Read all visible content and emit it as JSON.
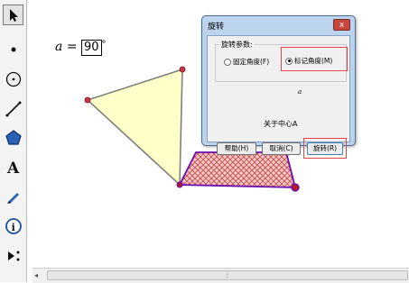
{
  "parameter": {
    "name": "a",
    "equals": "=",
    "value": "90",
    "unit": "°"
  },
  "dialog": {
    "title": "旋转",
    "close_label": "x",
    "group_label": "旋转参数:",
    "option_fixed": "固定角度(F)",
    "option_marked": "标记角度(M)",
    "angle_var": "a",
    "center_text": "关于中心A",
    "buttons": {
      "help": "帮助(H)",
      "cancel": "取消(C)",
      "rotate": "旋转(R)"
    },
    "selected_option": "option_marked"
  },
  "colors": {
    "triangle_fill": "#ffffc9",
    "triangle_stroke": "#7f7f7f",
    "trapezoid_fill": "#f4c7c7",
    "trapezoid_stroke": "#6a0dad",
    "point": "#b3162a",
    "highlight": "#e5434b",
    "dialog_frame": "#bcd3ee"
  },
  "toolbar": {
    "tools": [
      "arrow-select-icon",
      "point-icon",
      "compass-circle-icon",
      "straightedge-icon",
      "polygon-icon",
      "text-icon",
      "marker-pen-icon",
      "information-icon",
      "custom-tool-icon"
    ]
  }
}
